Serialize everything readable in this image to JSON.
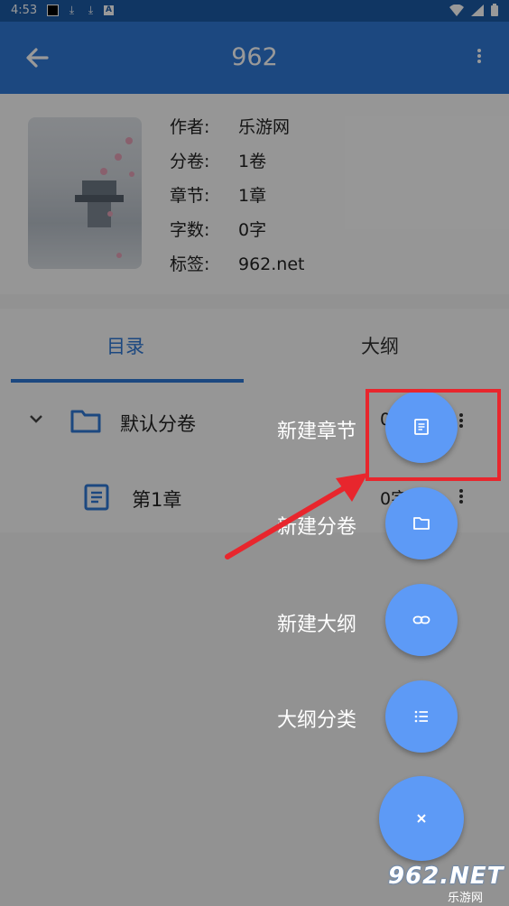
{
  "status_bar": {
    "time": "4:53"
  },
  "toolbar": {
    "title": "962"
  },
  "book": {
    "fields": [
      {
        "key": "作者:",
        "value": "乐游网"
      },
      {
        "key": "分卷:",
        "value": "1卷"
      },
      {
        "key": "章节:",
        "value": "1章"
      },
      {
        "key": "字数:",
        "value": "0字"
      },
      {
        "key": "标签:",
        "value": "962.net"
      }
    ]
  },
  "tabs": [
    {
      "label": "目录",
      "active": true
    },
    {
      "label": "大纲",
      "active": false
    }
  ],
  "volumes": [
    {
      "name": "默认分卷",
      "count": "0",
      "chapters": [
        {
          "name": "第1章",
          "count": "0字"
        }
      ]
    }
  ],
  "fab_menu": {
    "items": [
      {
        "label": "新建章节",
        "icon": "document-icon"
      },
      {
        "label": "新建分卷",
        "icon": "folder-icon"
      },
      {
        "label": "新建大纲",
        "icon": "link-icon"
      },
      {
        "label": "大纲分类",
        "icon": "list-icon"
      }
    ],
    "close_icon": "close-icon"
  },
  "colors": {
    "primary": "#2f78d6",
    "fab": "#5d9af6",
    "highlight": "#e8262d"
  },
  "watermark": {
    "top": "962.NET",
    "bottom": "乐游网"
  }
}
